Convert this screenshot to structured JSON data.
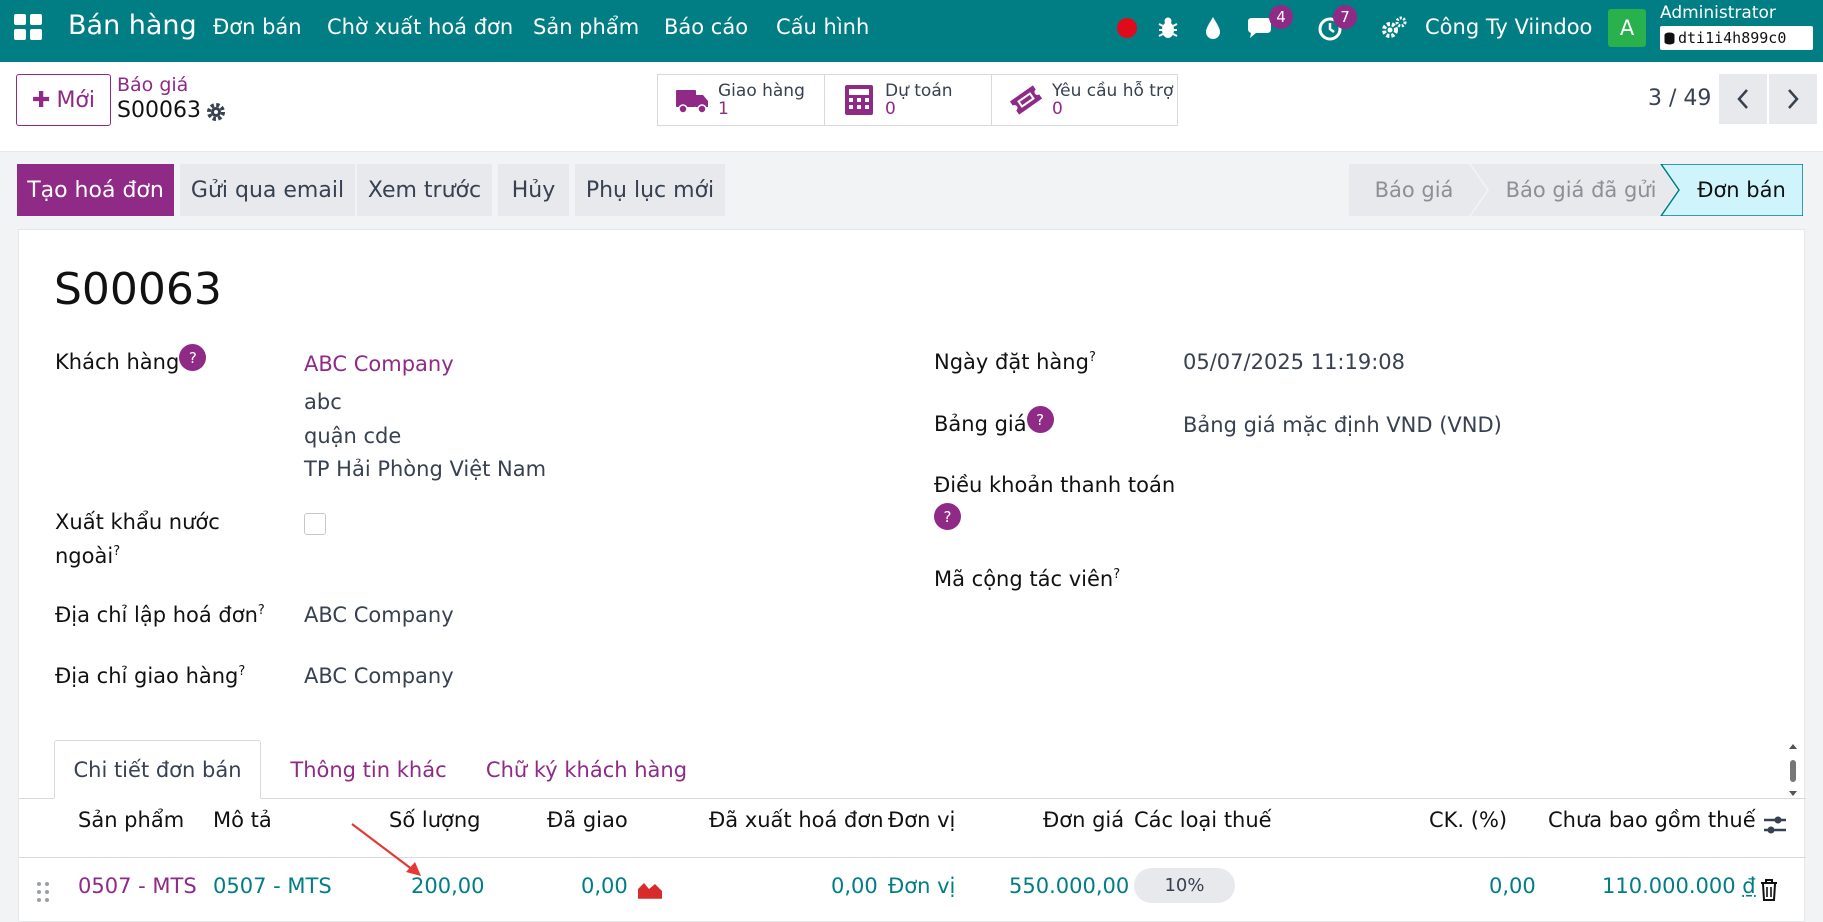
{
  "navbar": {
    "brand": "Bán hàng",
    "menu": [
      "Đơn bán",
      "Chờ xuất hoá đơn",
      "Sản phẩm",
      "Báo cáo",
      "Cấu hình"
    ],
    "messages_count": "4",
    "activities_count": "7",
    "company": "Công Ty Viindoo",
    "avatar_letter": "A",
    "user": "Administrator",
    "db": "dti1i4h899c0"
  },
  "control": {
    "new_label": "Mới",
    "breadcrumb_parent": "Báo giá",
    "breadcrumb_current": "S00063",
    "smart_buttons": [
      {
        "label": "Giao hàng",
        "value": "1"
      },
      {
        "label": "Dự toán",
        "value": "0"
      },
      {
        "label": "Yêu cầu hỗ trợ",
        "value": "0"
      }
    ],
    "pager": "3 / 49"
  },
  "actions": {
    "buttons": [
      "Tạo hoá đơn",
      "Gửi qua email",
      "Xem trước",
      "Hủy",
      "Phụ lục mới"
    ],
    "stages": [
      "Báo giá",
      "Báo giá đã gửi",
      "Đơn bán"
    ]
  },
  "form": {
    "title": "S00063",
    "customer_label": "Khách hàng",
    "customer_name": "ABC Company",
    "customer_address": [
      "abc",
      "quận cde",
      "TP Hải Phòng Việt Nam"
    ],
    "export_label_line1": "Xuất khẩu nước",
    "export_label_line2": "ngoài",
    "invoice_addr_label": "Địa chỉ lập hoá đơn",
    "invoice_addr_value": "ABC Company",
    "delivery_addr_label": "Địa chỉ giao hàng",
    "delivery_addr_value": "ABC Company",
    "order_date_label": "Ngày đặt hàng",
    "order_date_value": "05/07/2025 11:19:08",
    "pricelist_label": "Bảng giá",
    "pricelist_value": "Bảng giá mặc định VND (VND)",
    "payment_terms_label": "Điều khoản thanh toán",
    "referrer_label": "Mã cộng tác viên",
    "help_mark": "?"
  },
  "tabs": [
    "Chi tiết đơn bán",
    "Thông tin khác",
    "Chữ ký khách hàng"
  ],
  "order_lines": {
    "columns": [
      "Sản phẩm",
      "Mô tả",
      "Số lượng",
      "Đã giao",
      "Đã xuất hoá đơn",
      "Đơn vị",
      "Đơn giá",
      "Các loại thuế",
      "CK. (%)",
      "Chưa bao gồm thuế"
    ],
    "rows": [
      {
        "product": "0507 - MTS",
        "description": "0507 - MTS",
        "quantity": "200,00",
        "delivered": "0,00",
        "invoiced": "0,00",
        "uom": "Đơn vị",
        "price_unit": "550.000,00",
        "tax": "10%",
        "discount": "0,00",
        "subtotal": "110.000.000",
        "currency": "₫"
      }
    ]
  },
  "colors": {
    "navbar": "#017e84",
    "primary": "#8f2a87",
    "link_teal": "#017e84",
    "active_stage": "#cff4fc",
    "annotation_arrow": "#e53935"
  }
}
